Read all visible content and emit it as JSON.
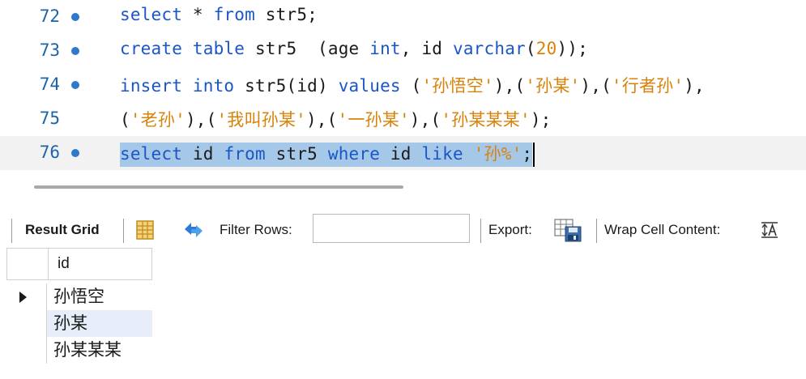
{
  "editor": {
    "lines": [
      {
        "num": "72",
        "marker": true
      },
      {
        "num": "73",
        "marker": true
      },
      {
        "num": "74",
        "marker": true
      },
      {
        "num": "75",
        "marker": false
      },
      {
        "num": "76",
        "marker": true
      }
    ],
    "l72": {
      "p1": "select",
      "p2": " * ",
      "p3": "from",
      "p4": " str5;"
    },
    "l73": {
      "p1": "create",
      "p2": " ",
      "p3": "table",
      "p4": " str5  (age ",
      "p5": "int",
      "p6": ", id ",
      "p7": "varchar",
      "p8": "(",
      "p9": "20",
      "p10": "));"
    },
    "l74": {
      "p1": "insert",
      "p2": " ",
      "p3": "into",
      "p4": " str5(id) ",
      "p5": "values",
      "p6": " (",
      "p7": "'孙悟空'",
      "p8": "),(",
      "p9": "'孙某'",
      "p10": "),(",
      "p11": "'行者孙'",
      "p12": "),"
    },
    "l75": {
      "p1": "(",
      "p2": "'老孙'",
      "p3": "),(",
      "p4": "'我叫孙某'",
      "p5": "),(",
      "p6": "'一孙某'",
      "p7": "),(",
      "p8": "'孙某某某'",
      "p9": ");"
    },
    "l76": {
      "p1": "select",
      "p2": " id ",
      "p3": "from",
      "p4": " str5 ",
      "p5": "where",
      "p6": " id ",
      "p7": "like",
      "p8": " ",
      "p9": "'孙%'",
      "p10": ";"
    }
  },
  "toolbar": {
    "result_grid": "Result Grid",
    "filter_rows": "Filter Rows:",
    "filter_value": "",
    "export": "Export:",
    "wrap_cell": "Wrap Cell Content:"
  },
  "grid": {
    "column": "id",
    "rows": [
      "孙悟空",
      "孙某",
      "孙某某某"
    ]
  },
  "icons": {
    "grid_view": "grid-view-icon",
    "refresh": "refresh-arrows-icon",
    "export": "export-save-icon",
    "wrap": "wrap-cell-icon"
  }
}
